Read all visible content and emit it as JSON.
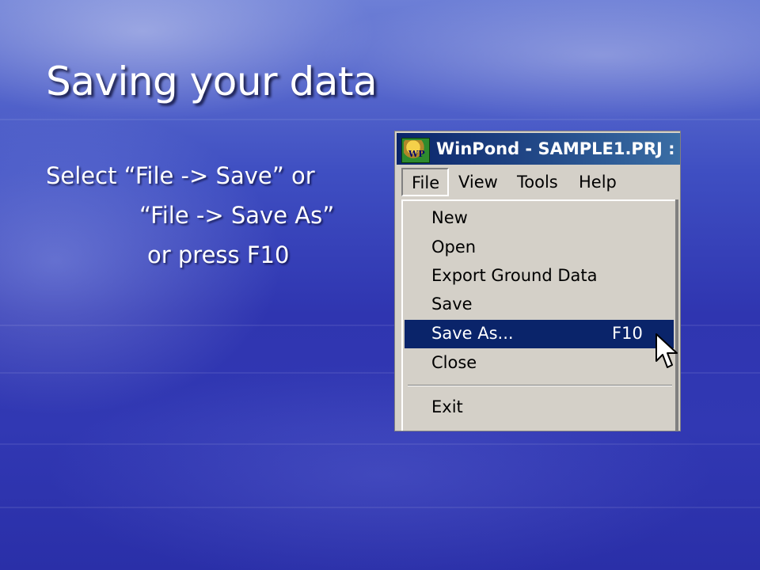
{
  "slide": {
    "title": "Saving your data",
    "bullet_lines": [
      "Select  “File -> Save” or",
      "“File -> Save As”",
      "or  press F10"
    ]
  },
  "screenshot": {
    "app_icon": "winpond-app-icon",
    "app_icon_text": "WP",
    "window_title": "WinPond - SAMPLE1.PRJ :",
    "menu_bar": [
      "File",
      "View",
      "Tools",
      "Help"
    ],
    "file_menu": {
      "items": [
        {
          "label": "New",
          "shortcut": ""
        },
        {
          "label": "Open",
          "shortcut": ""
        },
        {
          "label": "Export Ground Data",
          "shortcut": ""
        },
        {
          "label": "Save",
          "shortcut": ""
        },
        {
          "label": "Save As...",
          "shortcut": "F10",
          "highlighted": true
        },
        {
          "label": "Close",
          "shortcut": ""
        },
        {
          "label": "Exit",
          "shortcut": ""
        }
      ]
    },
    "cursor_icon": "arrow-cursor-icon",
    "colors": {
      "titlebar": "#0a246a",
      "menu_bg": "#d4d0c8",
      "highlight": "#0a246a"
    }
  }
}
